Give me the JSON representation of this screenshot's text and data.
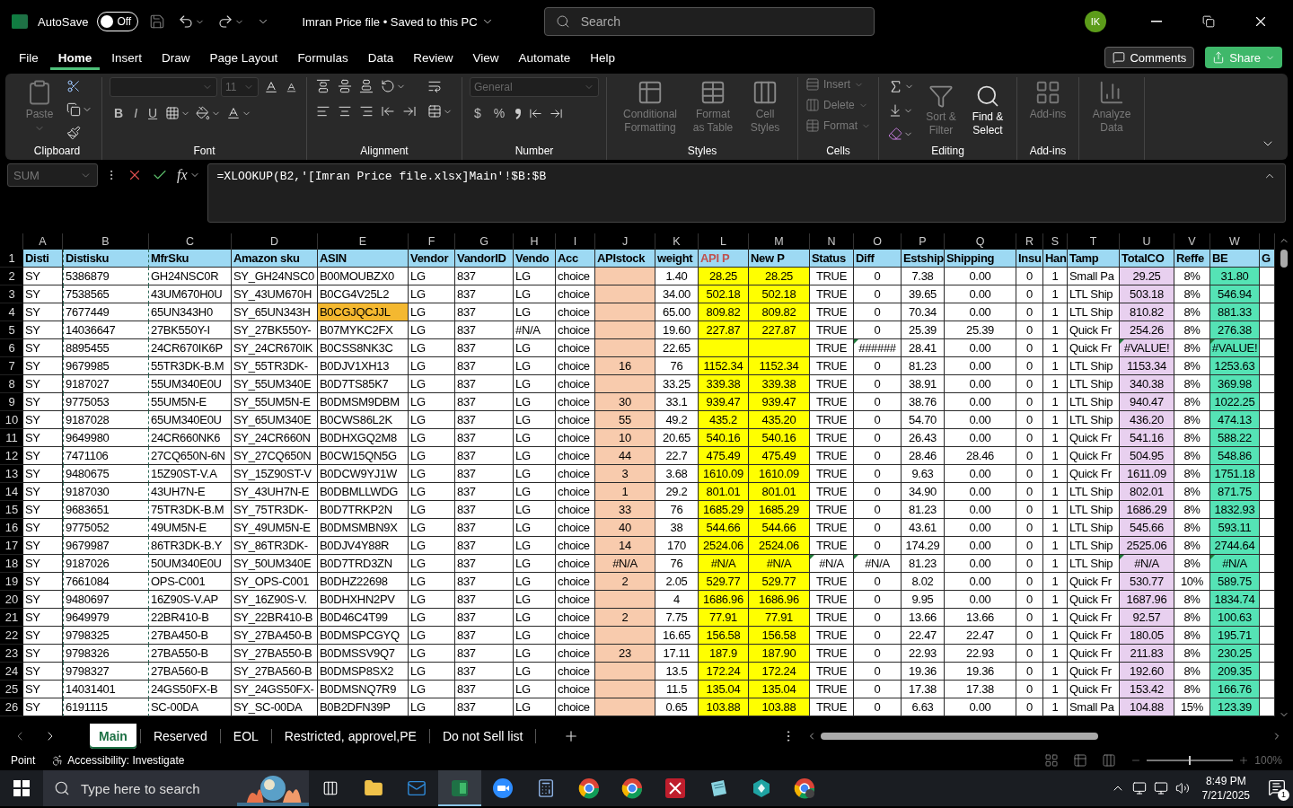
{
  "title_bar": {
    "autosave_label": "AutoSave",
    "autosave": {
      "label": "Off",
      "on": false
    },
    "title": "Imran Price file • Saved to this PC",
    "search": {
      "placeholder": "Search"
    },
    "avatar": "IK"
  },
  "menu": {
    "tabs": [
      {
        "label": "File",
        "selected": false
      },
      {
        "label": "Home",
        "selected": true
      },
      {
        "label": "Insert",
        "selected": false
      },
      {
        "label": "Draw",
        "selected": false
      },
      {
        "label": "Page Layout",
        "selected": false
      },
      {
        "label": "Formulas",
        "selected": false
      },
      {
        "label": "Data",
        "selected": false
      },
      {
        "label": "Review",
        "selected": false
      },
      {
        "label": "View",
        "selected": false
      },
      {
        "label": "Automate",
        "selected": false
      },
      {
        "label": "Help",
        "selected": false
      }
    ],
    "comments": "Comments",
    "share": "Share"
  },
  "ribbon": {
    "groups": [
      {
        "kind": "clipboard",
        "label": "Clipboard",
        "buttons": [
          {
            "label": "Paste",
            "disabled": true
          }
        ]
      },
      {
        "kind": "font",
        "label": "Font",
        "font_size": "11",
        "buttons": [
          {
            "label": "B",
            "disabled": false
          },
          {
            "label": "I",
            "disabled": false
          },
          {
            "label": "U",
            "disabled": false
          }
        ]
      },
      {
        "kind": "alignment",
        "label": "Alignment"
      },
      {
        "kind": "number",
        "label": "Number",
        "format": "General",
        "buttons": [
          {
            "label": "$",
            "disabled": false
          },
          {
            "label": "%",
            "disabled": false
          }
        ]
      },
      {
        "kind": "styles",
        "label": "Styles",
        "buttons": [
          {
            "label": "Conditional Formatting",
            "disabled": true
          },
          {
            "label": "Format as Table",
            "disabled": true
          },
          {
            "label": "Cell Styles",
            "disabled": true
          }
        ]
      },
      {
        "kind": "cells",
        "label": "Cells",
        "buttons": [
          {
            "label": "Insert",
            "disabled": true
          },
          {
            "label": "Delete",
            "disabled": true
          },
          {
            "label": "Format",
            "disabled": true
          }
        ]
      },
      {
        "kind": "editing",
        "label": "Editing",
        "buttons": [
          {
            "label": "Sort & Filter",
            "disabled": true
          },
          {
            "label": "Find & Select",
            "disabled": false
          }
        ]
      },
      {
        "kind": "addins",
        "label": "Add-ins",
        "buttons": [
          {
            "label": "Add-ins",
            "disabled": true
          }
        ]
      },
      {
        "kind": "analyze",
        "buttons": [
          {
            "label": "Analyze Data",
            "disabled": true
          }
        ]
      }
    ]
  },
  "formula_bar": {
    "name_box": "SUM",
    "function_button": "fx",
    "formula": "=XLOOKUP(B2,'[Imran Price file.xlsx]Main'!$B:$B"
  },
  "sheet": {
    "header_row_number": "1",
    "columns": [
      {
        "letter": "A",
        "header": "Disti"
      },
      {
        "letter": "B",
        "header": "Distisku",
        "copy_range": true
      },
      {
        "letter": "C",
        "header": "MfrSku"
      },
      {
        "letter": "D",
        "header": "Amazon sku"
      },
      {
        "letter": "E",
        "header": "ASIN"
      },
      {
        "letter": "F",
        "header": "Vendor"
      },
      {
        "letter": "G",
        "header": "VandorID"
      },
      {
        "letter": "H",
        "header": "Vendo"
      },
      {
        "letter": "I",
        "header": "Acc"
      },
      {
        "letter": "J",
        "header": "APIstock",
        "color": "#f8cbad"
      },
      {
        "letter": "K",
        "header": "weight"
      },
      {
        "letter": "L",
        "header": "API P",
        "color": "#ffff00",
        "header_highlight": true
      },
      {
        "letter": "M",
        "header": "New P",
        "color": "#ffff00"
      },
      {
        "letter": "N",
        "header": "Status"
      },
      {
        "letter": "O",
        "header": "Diff"
      },
      {
        "letter": "P",
        "header": "Estship"
      },
      {
        "letter": "Q",
        "header": "Shipping"
      },
      {
        "letter": "R",
        "header": "Insu"
      },
      {
        "letter": "S",
        "header": "Han"
      },
      {
        "letter": "T",
        "header": "Tamp"
      },
      {
        "letter": "U",
        "header": "TotalCO",
        "color": "#e8d0ef"
      },
      {
        "letter": "V",
        "header": "Reffe"
      },
      {
        "letter": "W",
        "header": "BE",
        "color": "#55e3b5"
      },
      {
        "header": "G"
      }
    ],
    "rows": [
      {
        "number": "2",
        "cells": [
          "SY",
          "5386879",
          "GH24NSC0R",
          "SY_GH24NSC0",
          "B00MOUBZX0",
          "LG",
          "837",
          "LG",
          "choice",
          null,
          "1.40",
          "28.25",
          "28.25",
          "TRUE",
          "0",
          "7.38",
          "0.00",
          "0",
          "1",
          "Small Pa",
          "29.25",
          "8%",
          "31.80"
        ]
      },
      {
        "number": "3",
        "cells": [
          "SY",
          "7538565",
          "43UM670H0U",
          "SY_43UM670H",
          "B0CG4V25L2",
          "LG",
          "837",
          "LG",
          "choice",
          null,
          "34.00",
          "502.18",
          "502.18",
          "TRUE",
          "0",
          "39.65",
          "0.00",
          "0",
          "1",
          "LTL Ship",
          "503.18",
          "8%",
          "546.94"
        ]
      },
      {
        "number": "4",
        "cells": [
          "SY",
          "7677449",
          "65UN343H0",
          "SY_65UN343H",
          {
            "text": "B0CGJQCJJL",
            "highlighted": true
          },
          "LG",
          "837",
          "LG",
          "choice",
          null,
          "65.00",
          "809.82",
          "809.82",
          "TRUE",
          "0",
          "70.34",
          "0.00",
          "0",
          "1",
          "LTL Ship",
          "810.82",
          "8%",
          "881.33"
        ]
      },
      {
        "number": "5",
        "cells": [
          "SY",
          "14036647",
          "27BK550Y-I",
          "SY_27BK550Y-",
          "B07MYKC2FX",
          "LG",
          "837",
          "#N/A",
          "choice",
          null,
          "19.60",
          "227.87",
          "227.87",
          "TRUE",
          "0",
          "25.39",
          "25.39",
          "0",
          "1",
          "Quick Fr",
          "254.26",
          "8%",
          "276.38"
        ]
      },
      {
        "number": "6",
        "cells": [
          "SY",
          "8895455",
          "24CR670IK6P",
          "SY_24CR670IK",
          "B0CSS8NK3C",
          "LG",
          "837",
          "LG",
          "choice",
          null,
          "22.65",
          null,
          null,
          "TRUE",
          {
            "text": "######",
            "flagged": true
          },
          "28.41",
          "0.00",
          "0",
          "1",
          "Quick Fr",
          {
            "text": "#VALUE!",
            "flagged": true
          },
          "8%",
          {
            "text": "#VALUE!",
            "flagged": true
          }
        ]
      },
      {
        "number": "7",
        "cells": [
          "SY",
          "9679985",
          "55TR3DK-B.M",
          "SY_55TR3DK-",
          "B0DJV1XH13",
          "LG",
          "837",
          "LG",
          "choice",
          "16",
          "76",
          "1152.34",
          "1152.34",
          "TRUE",
          "0",
          "81.23",
          "0.00",
          "0",
          "1",
          "LTL Ship",
          "1153.34",
          "8%",
          "1253.63"
        ]
      },
      {
        "number": "8",
        "cells": [
          "SY",
          "9187027",
          "55UM340E0U",
          "SY_55UM340E",
          "B0D7TS85K7",
          "LG",
          "837",
          "LG",
          "choice",
          null,
          "33.25",
          "339.38",
          "339.38",
          "TRUE",
          "0",
          "38.91",
          "0.00",
          "0",
          "1",
          "LTL Ship",
          "340.38",
          "8%",
          "369.98"
        ]
      },
      {
        "number": "9",
        "cells": [
          "SY",
          "9775053",
          "55UM5N-E",
          "SY_55UM5N-E",
          "B0DMSM9DBM",
          "LG",
          "837",
          "LG",
          "choice",
          "30",
          "33.1",
          "939.47",
          "939.47",
          "TRUE",
          "0",
          "38.76",
          "0.00",
          "0",
          "1",
          "LTL Ship",
          "940.47",
          "8%",
          "1022.25"
        ]
      },
      {
        "number": "10",
        "cells": [
          "SY",
          "9187028",
          "65UM340E0U",
          "SY_65UM340E",
          "B0CWS86L2K",
          "LG",
          "837",
          "LG",
          "choice",
          "55",
          "49.2",
          "435.2",
          "435.20",
          "TRUE",
          "0",
          "54.70",
          "0.00",
          "0",
          "1",
          "LTL Ship",
          "436.20",
          "8%",
          "474.13"
        ]
      },
      {
        "number": "11",
        "cells": [
          "SY",
          "9649980",
          "24CR660NK6",
          "SY_24CR660N",
          "B0DHXGQ2M8",
          "LG",
          "837",
          "LG",
          "choice",
          "10",
          "20.65",
          "540.16",
          "540.16",
          "TRUE",
          "0",
          "26.43",
          "0.00",
          "0",
          "1",
          "Quick Fr",
          "541.16",
          "8%",
          "588.22"
        ]
      },
      {
        "number": "12",
        "cells": [
          "SY",
          "7471106",
          "27CQ650N-6N",
          "SY_27CQ650N",
          "B0CW15QN5G",
          "LG",
          "837",
          "LG",
          "choice",
          "44",
          "22.7",
          "475.49",
          "475.49",
          "TRUE",
          "0",
          "28.46",
          "28.46",
          "0",
          "1",
          "Quick Fr",
          "504.95",
          "8%",
          "548.86"
        ]
      },
      {
        "number": "13",
        "cells": [
          "SY",
          "9480675",
          "15Z90ST-V.A",
          "SY_15Z90ST-V",
          "B0DCW9YJ1W",
          "LG",
          "837",
          "LG",
          "choice",
          "3",
          "3.68",
          "1610.09",
          "1610.09",
          "TRUE",
          "0",
          "9.63",
          "0.00",
          "0",
          "1",
          "Quick Fr",
          "1611.09",
          "8%",
          "1751.18"
        ]
      },
      {
        "number": "14",
        "cells": [
          "SY",
          "9187030",
          "43UH7N-E",
          "SY_43UH7N-E",
          "B0DBMLLWDG",
          "LG",
          "837",
          "LG",
          "choice",
          "1",
          "29.2",
          "801.01",
          "801.01",
          "TRUE",
          "0",
          "34.90",
          "0.00",
          "0",
          "1",
          "LTL Ship",
          "802.01",
          "8%",
          "871.75"
        ]
      },
      {
        "number": "15",
        "cells": [
          "SY",
          "9683651",
          "75TR3DK-B.M",
          "SY_75TR3DK-",
          "B0D7TRKP2N",
          "LG",
          "837",
          "LG",
          "choice",
          "33",
          "76",
          "1685.29",
          "1685.29",
          "TRUE",
          "0",
          "81.23",
          "0.00",
          "0",
          "1",
          "LTL Ship",
          "1686.29",
          "8%",
          "1832.93"
        ]
      },
      {
        "number": "16",
        "cells": [
          "SY",
          "9775052",
          "49UM5N-E",
          "SY_49UM5N-E",
          "B0DMSMBN9X",
          "LG",
          "837",
          "LG",
          "choice",
          "40",
          "38",
          "544.66",
          "544.66",
          "TRUE",
          "0",
          "43.61",
          "0.00",
          "0",
          "1",
          "LTL Ship",
          "545.66",
          "8%",
          "593.11"
        ]
      },
      {
        "number": "17",
        "cells": [
          "SY",
          "9679987",
          "86TR3DK-B.Y",
          "SY_86TR3DK-",
          "B0DJV4Y88R",
          "LG",
          "837",
          "LG",
          "choice",
          "14",
          "170",
          "2524.06",
          "2524.06",
          "TRUE",
          "0",
          "174.29",
          "0.00",
          "0",
          "1",
          "LTL Ship",
          "2525.06",
          "8%",
          "2744.64"
        ]
      },
      {
        "number": "18",
        "cells": [
          "SY",
          "9187026",
          "50UM340E0U",
          "SY_50UM340E",
          "B0D7TRD3ZN",
          "LG",
          "837",
          "LG",
          "choice",
          "#N/A",
          "76",
          "#N/A",
          "#N/A",
          {
            "text": "#N/A",
            "flagged": true
          },
          {
            "text": "#N/A",
            "flagged": true
          },
          "81.23",
          "0.00",
          "0",
          "1",
          "LTL Ship",
          {
            "text": "#N/A",
            "flagged": true
          },
          "8%",
          {
            "text": "#N/A",
            "flagged": true
          }
        ]
      },
      {
        "number": "19",
        "cells": [
          "SY",
          "7661084",
          "OPS-C001",
          "SY_OPS-C001",
          "B0DHZ22698",
          "LG",
          "837",
          "LG",
          "choice",
          "2",
          "2.05",
          "529.77",
          "529.77",
          "TRUE",
          "0",
          "8.02",
          "0.00",
          "0",
          "1",
          "Quick Fr",
          "530.77",
          "10%",
          "589.75"
        ]
      },
      {
        "number": "20",
        "cells": [
          "SY",
          "9480697",
          "16Z90S-V.AP",
          "SY_16Z90S-V.",
          "B0DHXHN2PV",
          "LG",
          "837",
          "LG",
          "choice",
          null,
          "4",
          "1686.96",
          "1686.96",
          "TRUE",
          "0",
          "9.95",
          "0.00",
          "0",
          "1",
          "Quick Fr",
          "1687.96",
          "8%",
          "1834.74"
        ]
      },
      {
        "number": "21",
        "cells": [
          "SY",
          "9649979",
          "22BR410-B",
          "SY_22BR410-B",
          "B0D46C4T99",
          "LG",
          "837",
          "LG",
          "choice",
          "2",
          "7.75",
          "77.91",
          "77.91",
          "TRUE",
          "0",
          "13.66",
          "13.66",
          "0",
          "1",
          "Quick Fr",
          "92.57",
          "8%",
          "100.63"
        ]
      },
      {
        "number": "22",
        "cells": [
          "SY",
          "9798325",
          "27BA450-B",
          "SY_27BA450-B",
          "B0DMSPCGYQ",
          "LG",
          "837",
          "LG",
          "choice",
          null,
          "16.65",
          "156.58",
          "156.58",
          "TRUE",
          "0",
          "22.47",
          "22.47",
          "0",
          "1",
          "Quick Fr",
          "180.05",
          "8%",
          "195.71"
        ]
      },
      {
        "number": "23",
        "cells": [
          "SY",
          "9798326",
          "27BA550-B",
          "SY_27BA550-B",
          "B0DMSSV9Q7",
          "LG",
          "837",
          "LG",
          "choice",
          "23",
          "17.11",
          "187.9",
          "187.90",
          "TRUE",
          "0",
          "22.93",
          "22.93",
          "0",
          "1",
          "Quick Fr",
          "211.83",
          "8%",
          "230.25"
        ]
      },
      {
        "number": "24",
        "cells": [
          "SY",
          "9798327",
          "27BA560-B",
          "SY_27BA560-B",
          "B0DMSP8SX2",
          "LG",
          "837",
          "LG",
          "choice",
          null,
          "13.5",
          "172.24",
          "172.24",
          "TRUE",
          "0",
          "19.36",
          "19.36",
          "0",
          "1",
          "Quick Fr",
          "192.60",
          "8%",
          "209.35"
        ]
      },
      {
        "number": "25",
        "cells": [
          "SY",
          "14031401",
          "24GS50FX-B",
          "SY_24GS50FX-",
          "B0DMSNQ7R9",
          "LG",
          "837",
          "LG",
          "choice",
          null,
          "11.5",
          "135.04",
          "135.04",
          "TRUE",
          "0",
          "17.38",
          "17.38",
          "0",
          "1",
          "Quick Fr",
          "153.42",
          "8%",
          "166.76"
        ]
      },
      {
        "number": "26",
        "cells": [
          "SY",
          "6191115",
          "SC-00DA",
          "SY_SC-00DA",
          "B0B2DFN39P",
          "LG",
          "837",
          "LG",
          "choice",
          null,
          "0.65",
          "103.88",
          "103.88",
          "TRUE",
          "0",
          "6.63",
          "0.00",
          "0",
          "1",
          "Small Pa",
          "104.88",
          "15%",
          "123.39"
        ]
      }
    ]
  },
  "sheet_tabs": [
    {
      "label": "Main",
      "selected": true
    },
    {
      "label": "Reserved",
      "selected": false
    },
    {
      "label": "EOL",
      "selected": false
    },
    {
      "label": "Restricted, approvel,PE",
      "selected": false
    },
    {
      "label": "Do not Sell list",
      "selected": false
    }
  ],
  "status_bar": {
    "mode": "Point",
    "accessibility": "Accessibility: Investigate",
    "zoom_slider": {
      "level": 0.5
    },
    "zoom": "100%"
  },
  "taskbar": {
    "search": {
      "placeholder": "Type here to search"
    },
    "time": "8:49 PM",
    "date": "7/21/2025",
    "notifications": "1"
  }
}
